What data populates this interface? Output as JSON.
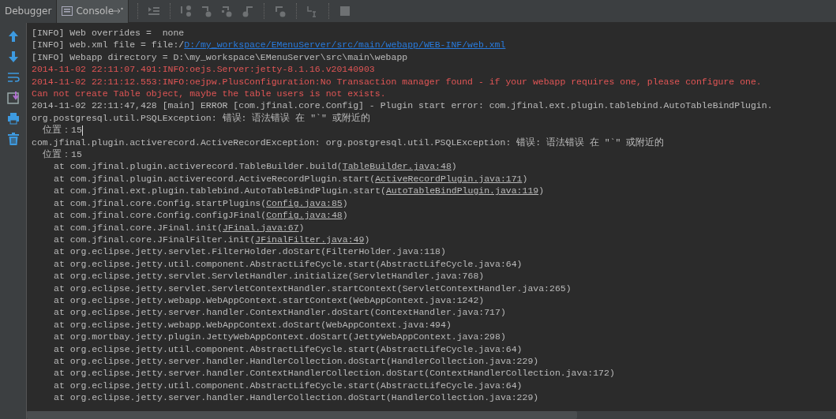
{
  "tabs": [
    {
      "label": "Debugger",
      "selected": false
    },
    {
      "label": "Console",
      "selected": true
    }
  ],
  "log": [
    {
      "kind": "info",
      "parts": [
        {
          "text": "[INFO] Web overrides =  none",
          "link": false
        }
      ]
    },
    {
      "kind": "info",
      "parts": [
        {
          "text": "[INFO] web.xml file = file:/",
          "link": false
        },
        {
          "text": "D:/my_workspace/EMenuServer/src/main/webapp/WEB-INF/web.xml",
          "link": true
        }
      ]
    },
    {
      "kind": "info",
      "parts": [
        {
          "text": "[INFO] Webapp directory = D:\\my_workspace\\EMenuServer\\src\\main\\webapp",
          "link": false
        }
      ]
    },
    {
      "kind": "error",
      "parts": [
        {
          "text": "2014-11-02 22:11:07.491:INFO:oejs.Server:jetty-8.1.16.v20140903",
          "link": false
        }
      ]
    },
    {
      "kind": "error",
      "parts": [
        {
          "text": "2014-11-02 22:11:12.553:INFO:oejpw.PlusConfiguration:No Transaction manager found - if your webapp requires one, please configure one.",
          "link": false
        }
      ]
    },
    {
      "kind": "error",
      "parts": [
        {
          "text": "Can not create Table object, maybe the table users is not exists.",
          "link": false
        }
      ]
    },
    {
      "kind": "info",
      "parts": [
        {
          "text": "2014-11-02 22:11:47,428 [main] ERROR [com.jfinal.core.Config] - Plugin start error: com.jfinal.ext.plugin.tablebind.AutoTableBindPlugin.",
          "link": false
        }
      ]
    },
    {
      "kind": "info",
      "parts": [
        {
          "text": "org.postgresql.util.PSQLException: 错误: 语法错误 在 \"`\" 或附近的",
          "link": false
        }
      ]
    },
    {
      "kind": "detail",
      "cursor": true,
      "parts": [
        {
          "text": "位置：15",
          "link": false
        }
      ]
    },
    {
      "kind": "info",
      "parts": [
        {
          "text": "com.jfinal.plugin.activerecord.ActiveRecordException: org.postgresql.util.PSQLException: 错误: 语法错误 在 \"`\" 或附近的",
          "link": false
        }
      ]
    },
    {
      "kind": "detail",
      "cursor": false,
      "parts": [
        {
          "text": "位置：15",
          "link": false
        }
      ]
    },
    {
      "kind": "frame",
      "parts": [
        {
          "text": "at com.jfinal.plugin.activerecord.TableBuilder.build(",
          "link": false
        },
        {
          "text": "TableBuilder.java:48",
          "link": true
        },
        {
          "text": ")",
          "link": false
        }
      ]
    },
    {
      "kind": "frame",
      "parts": [
        {
          "text": "at com.jfinal.plugin.activerecord.ActiveRecordPlugin.start(",
          "link": false
        },
        {
          "text": "ActiveRecordPlugin.java:171",
          "link": true
        },
        {
          "text": ")",
          "link": false
        }
      ]
    },
    {
      "kind": "frame",
      "parts": [
        {
          "text": "at com.jfinal.ext.plugin.tablebind.AutoTableBindPlugin.start(",
          "link": false
        },
        {
          "text": "AutoTableBindPlugin.java:119",
          "link": true
        },
        {
          "text": ")",
          "link": false
        }
      ]
    },
    {
      "kind": "frame",
      "parts": [
        {
          "text": "at com.jfinal.core.Config.startPlugins(",
          "link": false
        },
        {
          "text": "Config.java:85",
          "link": true
        },
        {
          "text": ")",
          "link": false
        }
      ]
    },
    {
      "kind": "frame",
      "parts": [
        {
          "text": "at com.jfinal.core.Config.configJFinal(",
          "link": false
        },
        {
          "text": "Config.java:48",
          "link": true
        },
        {
          "text": ")",
          "link": false
        }
      ]
    },
    {
      "kind": "frame",
      "parts": [
        {
          "text": "at com.jfinal.core.JFinal.init(",
          "link": false
        },
        {
          "text": "JFinal.java:67",
          "link": true
        },
        {
          "text": ")",
          "link": false
        }
      ]
    },
    {
      "kind": "frame",
      "parts": [
        {
          "text": "at com.jfinal.core.JFinalFilter.init(",
          "link": false
        },
        {
          "text": "JFinalFilter.java:49",
          "link": true
        },
        {
          "text": ")",
          "link": false
        }
      ]
    },
    {
      "kind": "frame",
      "parts": [
        {
          "text": "at org.eclipse.jetty.servlet.FilterHolder.doStart(FilterHolder.java:118)",
          "link": false
        }
      ]
    },
    {
      "kind": "frame",
      "parts": [
        {
          "text": "at org.eclipse.jetty.util.component.AbstractLifeCycle.start(AbstractLifeCycle.java:64)",
          "link": false
        }
      ]
    },
    {
      "kind": "frame",
      "parts": [
        {
          "text": "at org.eclipse.jetty.servlet.ServletHandler.initialize(ServletHandler.java:768)",
          "link": false
        }
      ]
    },
    {
      "kind": "frame",
      "parts": [
        {
          "text": "at org.eclipse.jetty.servlet.ServletContextHandler.startContext(ServletContextHandler.java:265)",
          "link": false
        }
      ]
    },
    {
      "kind": "frame",
      "parts": [
        {
          "text": "at org.eclipse.jetty.webapp.WebAppContext.startContext(WebAppContext.java:1242)",
          "link": false
        }
      ]
    },
    {
      "kind": "frame",
      "parts": [
        {
          "text": "at org.eclipse.jetty.server.handler.ContextHandler.doStart(ContextHandler.java:717)",
          "link": false
        }
      ]
    },
    {
      "kind": "frame",
      "parts": [
        {
          "text": "at org.eclipse.jetty.webapp.WebAppContext.doStart(WebAppContext.java:494)",
          "link": false
        }
      ]
    },
    {
      "kind": "frame",
      "parts": [
        {
          "text": "at org.mortbay.jetty.plugin.JettyWebAppContext.doStart(JettyWebAppContext.java:298)",
          "link": false
        }
      ]
    },
    {
      "kind": "frame",
      "parts": [
        {
          "text": "at org.eclipse.jetty.util.component.AbstractLifeCycle.start(AbstractLifeCycle.java:64)",
          "link": false
        }
      ]
    },
    {
      "kind": "frame",
      "parts": [
        {
          "text": "at org.eclipse.jetty.server.handler.HandlerCollection.doStart(HandlerCollection.java:229)",
          "link": false
        }
      ]
    },
    {
      "kind": "frame",
      "parts": [
        {
          "text": "at org.eclipse.jetty.server.handler.ContextHandlerCollection.doStart(ContextHandlerCollection.java:172)",
          "link": false
        }
      ]
    },
    {
      "kind": "frame",
      "parts": [
        {
          "text": "at org.eclipse.jetty.util.component.AbstractLifeCycle.start(AbstractLifeCycle.java:64)",
          "link": false
        }
      ]
    },
    {
      "kind": "frame",
      "parts": [
        {
          "text": "at org.eclipse.jetty.server.handler.HandlerCollection.doStart(HandlerCollection.java:229)",
          "link": false
        }
      ]
    }
  ]
}
